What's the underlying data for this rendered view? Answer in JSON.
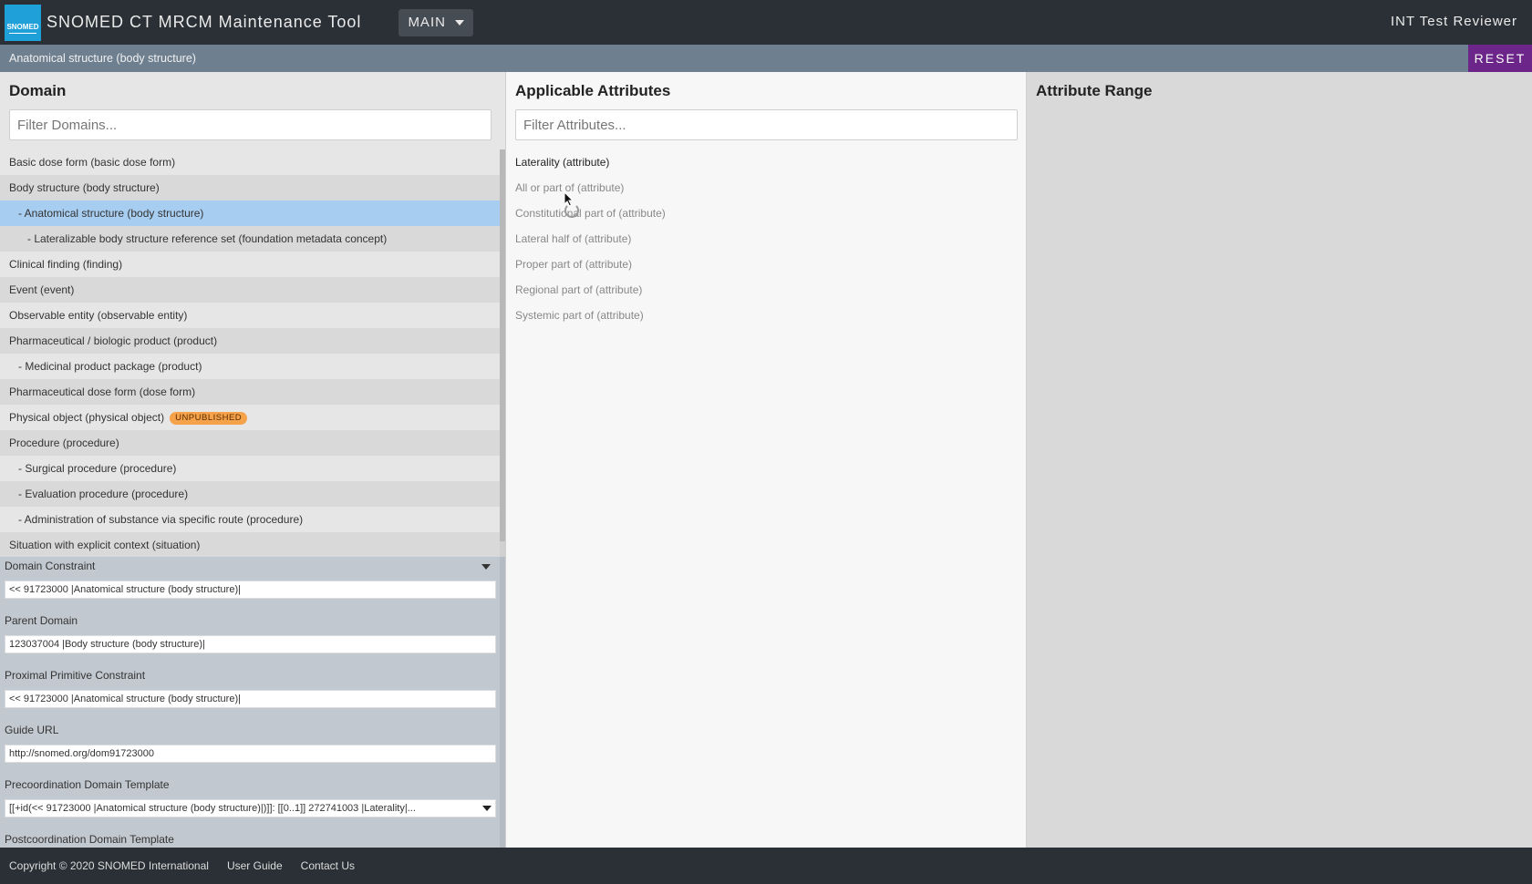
{
  "header": {
    "logo_text": "SNOMED",
    "app_title": "SNOMED CT MRCM Maintenance Tool",
    "branch_label": "MAIN",
    "user": "INT Test Reviewer"
  },
  "breadcrumb": {
    "text": "Anatomical structure (body structure)",
    "reset_label": "RESET"
  },
  "domain_panel": {
    "title": "Domain",
    "filter_placeholder": "Filter Domains...",
    "items": [
      {
        "label": "Basic dose form (basic dose form)",
        "level": 0
      },
      {
        "label": "Body structure (body structure)",
        "level": 0
      },
      {
        "label": "- Anatomical structure (body structure)",
        "level": 1,
        "selected": true
      },
      {
        "label": "- Lateralizable body structure reference set (foundation metadata concept)",
        "level": 2
      },
      {
        "label": "Clinical finding (finding)",
        "level": 0
      },
      {
        "label": "Event (event)",
        "level": 0
      },
      {
        "label": "Observable entity (observable entity)",
        "level": 0
      },
      {
        "label": "Pharmaceutical / biologic product (product)",
        "level": 0
      },
      {
        "label": "- Medicinal product package (product)",
        "level": 1
      },
      {
        "label": "Pharmaceutical dose form (dose form)",
        "level": 0
      },
      {
        "label": "Physical object (physical object)",
        "level": 0,
        "badge": "UNPUBLISHED"
      },
      {
        "label": "Procedure (procedure)",
        "level": 0
      },
      {
        "label": "- Surgical procedure (procedure)",
        "level": 1
      },
      {
        "label": "- Evaluation procedure (procedure)",
        "level": 1
      },
      {
        "label": "- Administration of substance via specific route (procedure)",
        "level": 1
      },
      {
        "label": "Situation with explicit context (situation)",
        "level": 0
      }
    ]
  },
  "domain_details": {
    "domain_constraint_label": "Domain Constraint",
    "domain_constraint_value": "<< 91723000 |Anatomical structure (body structure)|",
    "parent_domain_label": "Parent Domain",
    "parent_domain_value": "123037004 |Body structure (body structure)|",
    "proximal_primitive_label": "Proximal Primitive Constraint",
    "proximal_primitive_value": "<< 91723000 |Anatomical structure (body structure)|",
    "guide_url_label": "Guide URL",
    "guide_url_value": "http://snomed.org/dom91723000",
    "precoord_label": "Precoordination Domain Template",
    "precoord_value": "[[+id(<< 91723000 |Anatomical structure (body structure)|)]]: [[0..1]] 272741003 |Laterality|...",
    "postcoord_label": "Postcoordination Domain Template"
  },
  "attributes_panel": {
    "title": "Applicable Attributes",
    "filter_placeholder": "Filter Attributes...",
    "items": [
      {
        "label": "Laterality (attribute)",
        "active": true
      },
      {
        "label": "All or part of (attribute)",
        "active": false
      },
      {
        "label": "Constitutional part of (attribute)",
        "active": false
      },
      {
        "label": "Lateral half of (attribute)",
        "active": false
      },
      {
        "label": "Proper part of (attribute)",
        "active": false
      },
      {
        "label": "Regional part of (attribute)",
        "active": false
      },
      {
        "label": "Systemic part of (attribute)",
        "active": false
      }
    ]
  },
  "range_panel": {
    "title": "Attribute Range"
  },
  "footer": {
    "copyright": "Copyright © 2020 SNOMED International",
    "user_guide": "User Guide",
    "contact_us": "Contact Us"
  },
  "colors": {
    "header_bg": "#2b3036",
    "breadcrumb_bg": "#6e7f90",
    "reset_bg": "#6c2588",
    "selected_row": "#a7cdf0",
    "badge_bg": "#f5a24a",
    "logo_bg": "#1fa0d8"
  }
}
